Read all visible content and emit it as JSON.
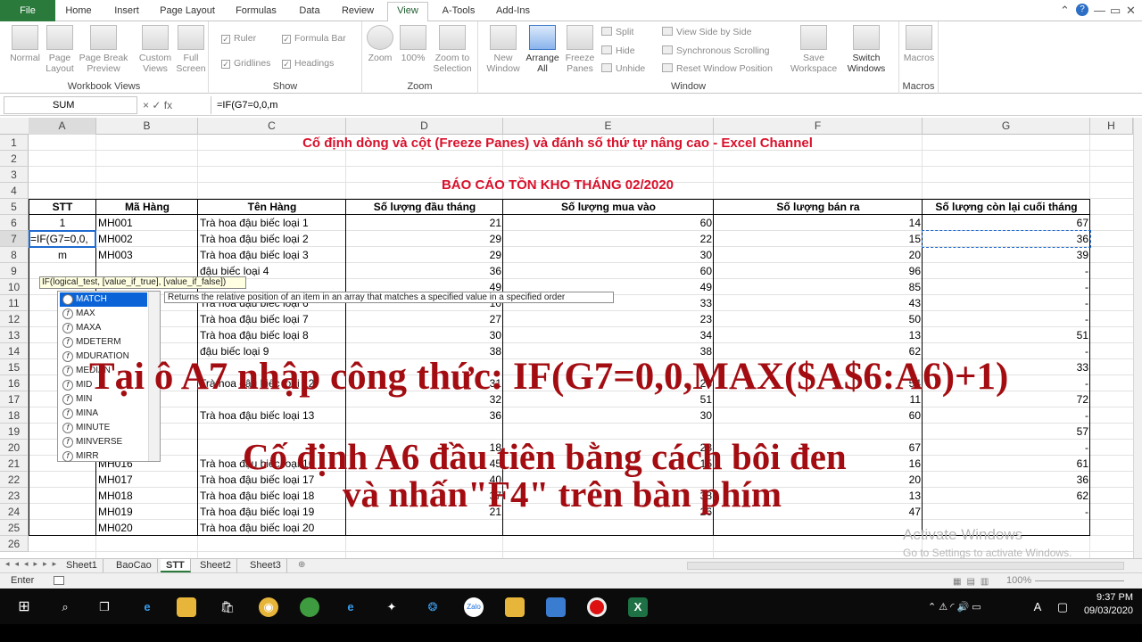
{
  "ribbon_tabs": {
    "file": "File",
    "home": "Home",
    "insert": "Insert",
    "page_layout": "Page Layout",
    "formulas": "Formulas",
    "data": "Data",
    "review": "Review",
    "view": "View",
    "atools": "A-Tools",
    "addins": "Add-Ins"
  },
  "ribbon": {
    "workbook_views": {
      "label": "Workbook Views",
      "normal": "Normal",
      "page_layout": "Page Layout",
      "page_break": "Page Break Preview",
      "custom_views": "Custom Views",
      "full_screen": "Full Screen"
    },
    "show": {
      "label": "Show",
      "ruler": "Ruler",
      "gridlines": "Gridlines",
      "formula_bar": "Formula Bar",
      "headings": "Headings"
    },
    "zoom": {
      "label": "Zoom",
      "zoom": "Zoom",
      "hundred": "100%",
      "zoom_selection": "Zoom to Selection"
    },
    "window": {
      "label": "Window",
      "new_window": "New Window",
      "arrange_all": "Arrange All",
      "freeze_panes": "Freeze Panes",
      "split": "Split",
      "hide": "Hide",
      "unhide": "Unhide",
      "side_by_side": "View Side by Side",
      "sync_scroll": "Synchronous Scrolling",
      "reset_position": "Reset Window Position",
      "save_workspace": "Save Workspace",
      "switch_windows": "Switch Windows"
    },
    "macros": {
      "label": "Macros",
      "macros": "Macros"
    }
  },
  "formula_bar": {
    "name_box": "SUM",
    "controls": "×  ✓  fx",
    "formula": "=IF(G7=0,0,m"
  },
  "columns": [
    "A",
    "B",
    "C",
    "D",
    "E",
    "F",
    "G",
    "H"
  ],
  "rows": [
    "1",
    "2",
    "3",
    "4",
    "5",
    "6",
    "7",
    "8",
    "9",
    "10",
    "11",
    "12",
    "13",
    "14",
    "15",
    "16",
    "17",
    "18",
    "19",
    "20",
    "21",
    "22",
    "23",
    "24",
    "25",
    "26"
  ],
  "sheet": {
    "title": "Cố định dòng và cột (Freeze Panes) và đánh số thứ tự nâng cao - Excel Channel",
    "report_title": "BÁO CÁO TỒN KHO THÁNG 02/2020",
    "headers": [
      "STT",
      "Mã Hàng",
      "Tên Hàng",
      "Số lượng đầu tháng",
      "Số lượng mua vào",
      "Số lượng bán ra",
      "Số lượng còn lại cuối tháng"
    ],
    "a6": "1",
    "a7": "=IF(G7=0,0,",
    "a8": "m",
    "codes": [
      "MH001",
      "MH002",
      "MH003",
      "MH016",
      "MH017",
      "MH018",
      "MH019",
      "MH020"
    ],
    "names": [
      "Trà hoa đậu biếc loại 1",
      "Trà hoa đậu biếc loại 2",
      "Trà hoa đậu biếc loại 3",
      "đậu biếc loại 4",
      "Trà hoa đậu biếc loại 6",
      "Trà hoa đậu biếc loại 7",
      "Trà hoa đậu biếc loại 8",
      "đậu biếc loại 9",
      "Trà hoa đậu biếc loại 12",
      "Trà hoa đậu biếc loại 13",
      "Trà hoa đậu biếc loại 16",
      "Trà hoa đậu biếc loại 17",
      "Trà hoa đậu biếc loại 18",
      "Trà hoa đậu biếc loại 19",
      "Trà hoa đậu biếc loại 20"
    ],
    "d": [
      "21",
      "29",
      "29",
      "36",
      "49",
      "10",
      "27",
      "30",
      "38",
      "",
      "31",
      "32",
      "36",
      "",
      "18",
      "45",
      "40",
      "37",
      "21"
    ],
    "e": [
      "60",
      "22",
      "30",
      "60",
      "49",
      "33",
      "23",
      "34",
      "38",
      "",
      "23",
      "51",
      "30",
      "",
      "28",
      "15",
      "",
      "38",
      "26"
    ],
    "f": [
      "14",
      "15",
      "20",
      "96",
      "85",
      "43",
      "50",
      "13",
      "62",
      "",
      "54",
      "11",
      "60",
      "",
      "67",
      "16",
      "20",
      "13",
      "47"
    ],
    "g": [
      "67",
      "36",
      "39",
      "-",
      "-",
      "-",
      "-",
      "51",
      "-",
      "33",
      "-",
      "72",
      "-",
      "57",
      "-",
      "61",
      "36",
      "62",
      "-"
    ]
  },
  "autocomplete": {
    "tooltip": "IF(logical_test, [value_if_true], [value_if_false])",
    "items": [
      "MATCH",
      "MAX",
      "MAXA",
      "MDETERM",
      "MDURATION",
      "MEDIAN",
      "MID",
      "MIN",
      "MINA",
      "MINUTE",
      "MINVERSE",
      "MIRR"
    ],
    "description": "Returns the relative position of an item in an array that matches a specified value in a specified order"
  },
  "overlay": {
    "line1": "Tại ô A7 nhập công thức: IF(G7=0,0,MAX($A$6:A6)+1)",
    "line2": "Cố định A6 đầu tiên bằng cách bôi đen",
    "line3": "và nhấn\"F4\" trên bàn phím"
  },
  "watermark": {
    "line1": "Activate Windows",
    "line2": "Go to Settings to activate Windows."
  },
  "sheet_tabs": [
    "Sheet1",
    "BaoCao",
    "STT",
    "Sheet2",
    "Sheet3"
  ],
  "status": {
    "mode": "Enter",
    "zoom": "100%"
  },
  "taskbar": {
    "time": "9:37 PM",
    "date": "09/03/2020",
    "lang": "A"
  }
}
